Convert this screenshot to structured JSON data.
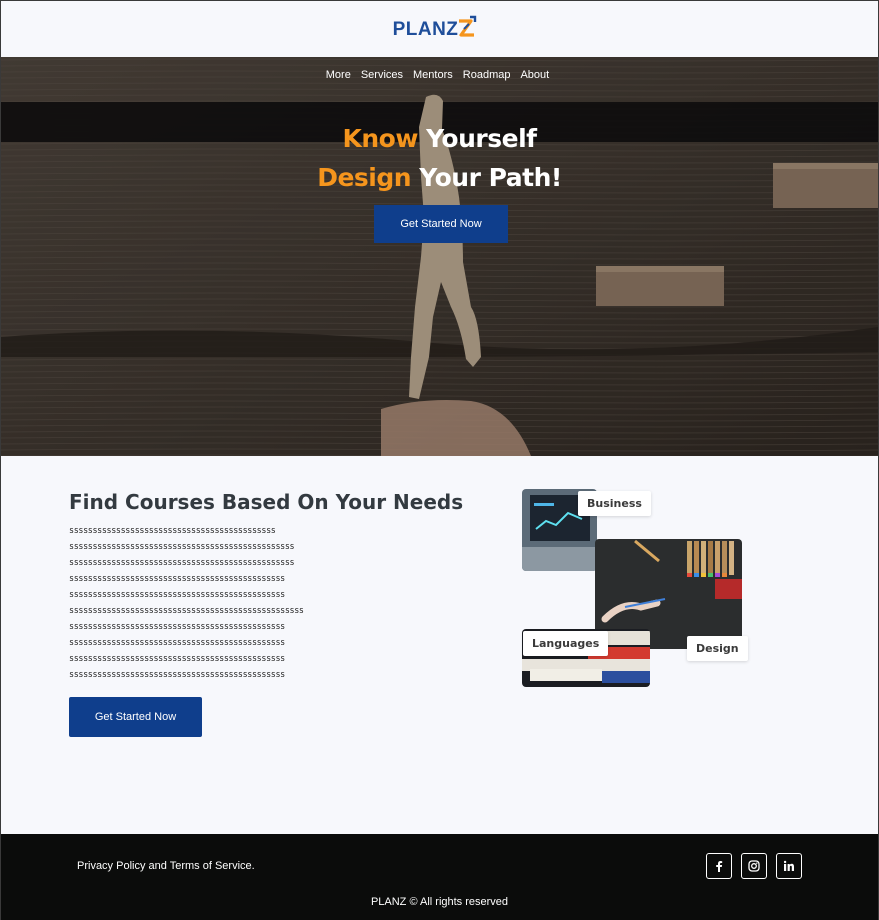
{
  "header": {
    "logo_text": "PLANZ",
    "logo_mark": "Z-arrow-logo",
    "colors": {
      "brand_blue": "#1f4e9a",
      "brand_orange": "#f5951d"
    }
  },
  "nav": {
    "items": [
      {
        "label": "More"
      },
      {
        "label": "Services"
      },
      {
        "label": "Mentors"
      },
      {
        "label": "Roadmap"
      },
      {
        "label": "About"
      }
    ]
  },
  "hero": {
    "line1_accent": "Know",
    "line1_rest": " Yourself",
    "line2_accent": "Design",
    "line2_rest": " Your Path!",
    "cta_label": "Get Started Now",
    "accent_color": "#f5951d",
    "button_color": "#0f3e8c"
  },
  "courses": {
    "title": "Find Courses Based On Your Needs",
    "filler_lines": [
      "ssssssssssssssssssssssssssssssssssssssssssss",
      "ssssssssssssssssssssssssssssssssssssssssssssssss",
      "ssssssssssssssssssssssssssssssssssssssssssssssss",
      "ssssssssssssssssssssssssssssssssssssssssssssss",
      "ssssssssssssssssssssssssssssssssssssssssssssss",
      "ssssssssssssssssssssssssssssssssssssssssssssssssss",
      "ssssssssssssssssssssssssssssssssssssssssssssss",
      "ssssssssssssssssssssssssssssssssssssssssssssss",
      "ssssssssssssssssssssssssssssssssssssssssssssss",
      "ssssssssssssssssssssssssssssssssssssssssssssss"
    ],
    "cta_label": "Get Started Now",
    "tags": {
      "business": "Business",
      "languages": "Languages",
      "design": "Design"
    }
  },
  "footer": {
    "policy": "Privacy Policy and Terms of Service.",
    "copyright": "PLANZ © All rights reserved",
    "socials": [
      {
        "icon": "facebook-icon",
        "glyph": "f"
      },
      {
        "icon": "instagram-icon",
        "glyph": "◎"
      },
      {
        "icon": "linkedin-icon",
        "glyph": "in"
      }
    ]
  }
}
